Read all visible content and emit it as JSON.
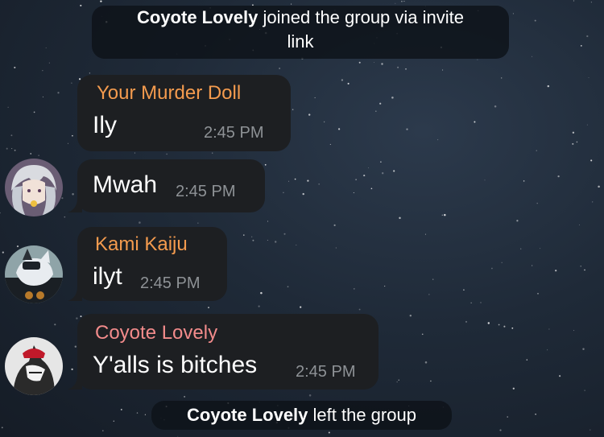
{
  "events": {
    "joined": {
      "name": "Coyote Lovely",
      "text": "joined the group via invite",
      "text2": "link"
    },
    "left": {
      "name": "Coyote Lovely",
      "text": "left the group"
    }
  },
  "messages": [
    {
      "sender": "Your Murder Doll",
      "sender_color": "#f49b4e",
      "text": "Ily",
      "time": "2:45 PM"
    },
    {
      "sender": "",
      "text": "Mwah",
      "time": "2:45 PM",
      "avatar": "silver-hair-anime-avatar"
    },
    {
      "sender": "Kami Kaiju",
      "sender_color": "#f49b4e",
      "text": "ilyt",
      "time": "2:45 PM",
      "avatar": "wolf-character-avatar"
    },
    {
      "sender": "Coyote Lovely",
      "sender_color": "#f28b8b",
      "text": "Y'alls is bitches",
      "time": "2:45 PM",
      "avatar": "dog-character-avatar"
    }
  ],
  "colors": {
    "bubble": "#1d1f22",
    "service_bg": "#0e1218",
    "time": "#8e9296"
  }
}
